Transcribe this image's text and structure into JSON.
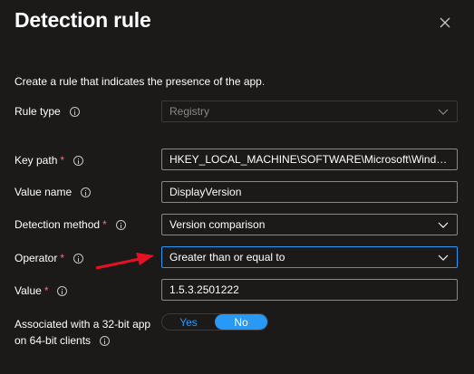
{
  "panel": {
    "title": "Detection rule"
  },
  "intro": "Create a rule that indicates the presence of the app.",
  "rule_type": {
    "label": "Rule type",
    "value": "Registry"
  },
  "key_path": {
    "label": "Key path",
    "required": "*",
    "value": "HKEY_LOCAL_MACHINE\\SOFTWARE\\Microsoft\\Windows\\C..."
  },
  "value_name": {
    "label": "Value name",
    "value": "DisplayVersion"
  },
  "detection_method": {
    "label": "Detection method",
    "required": "*",
    "value": "Version comparison"
  },
  "operator": {
    "label": "Operator",
    "required": "*",
    "value": "Greater than or equal to"
  },
  "value": {
    "label": "Value",
    "required": "*",
    "value": "1.5.3.2501222"
  },
  "associated": {
    "label_line1": "Associated with a 32-bit app",
    "label_line2": "on 64-bit clients",
    "yes_label": "Yes",
    "no_label": "No",
    "selected": "No"
  },
  "colors": {
    "background": "#1b1a19",
    "accent": "#2899f5",
    "required": "#f1707b",
    "annotation_arrow": "#e81123"
  },
  "icons": [
    "close-icon",
    "info-icon",
    "chevron-down-icon",
    "red-arrow"
  ]
}
